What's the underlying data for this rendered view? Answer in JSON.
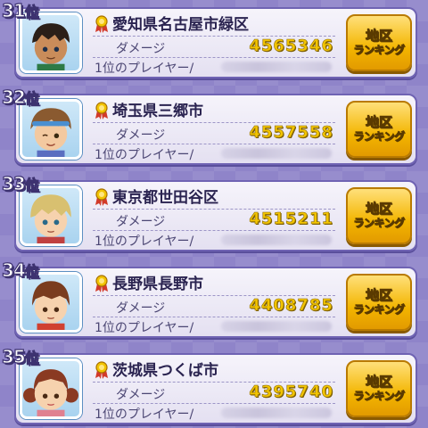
{
  "colors": {
    "background": "#8f84c9",
    "card_border": "#6f63b3",
    "damage_value": "#f2c400",
    "button": "#f3b500"
  },
  "labels": {
    "rank_suffix": "位",
    "damage_label": "ダメージ",
    "player_label": "1位のプレイヤー/",
    "button_line1": "地区",
    "button_line2": "ランキング"
  },
  "entries": [
    {
      "rank": "31",
      "region": "愛知県名古屋市緑区",
      "damage": "4565346",
      "player": "",
      "medal_icon": "medal-icon",
      "avatar": "dark-haired-boy"
    },
    {
      "rank": "32",
      "region": "埼玉県三郷市",
      "damage": "4557558",
      "player": "",
      "medal_icon": "medal-icon",
      "avatar": "headband-boy"
    },
    {
      "rank": "33",
      "region": "東京都世田谷区",
      "damage": "4515211",
      "player": "",
      "medal_icon": "medal-icon",
      "avatar": "blonde-boy"
    },
    {
      "rank": "34",
      "region": "長野県長野市",
      "damage": "4408785",
      "player": "",
      "medal_icon": "medal-icon",
      "avatar": "brown-haired-boy"
    },
    {
      "rank": "35",
      "region": "茨城県つくば市",
      "damage": "4395740",
      "player": "",
      "medal_icon": "medal-icon",
      "avatar": "pigtail-girl"
    }
  ]
}
